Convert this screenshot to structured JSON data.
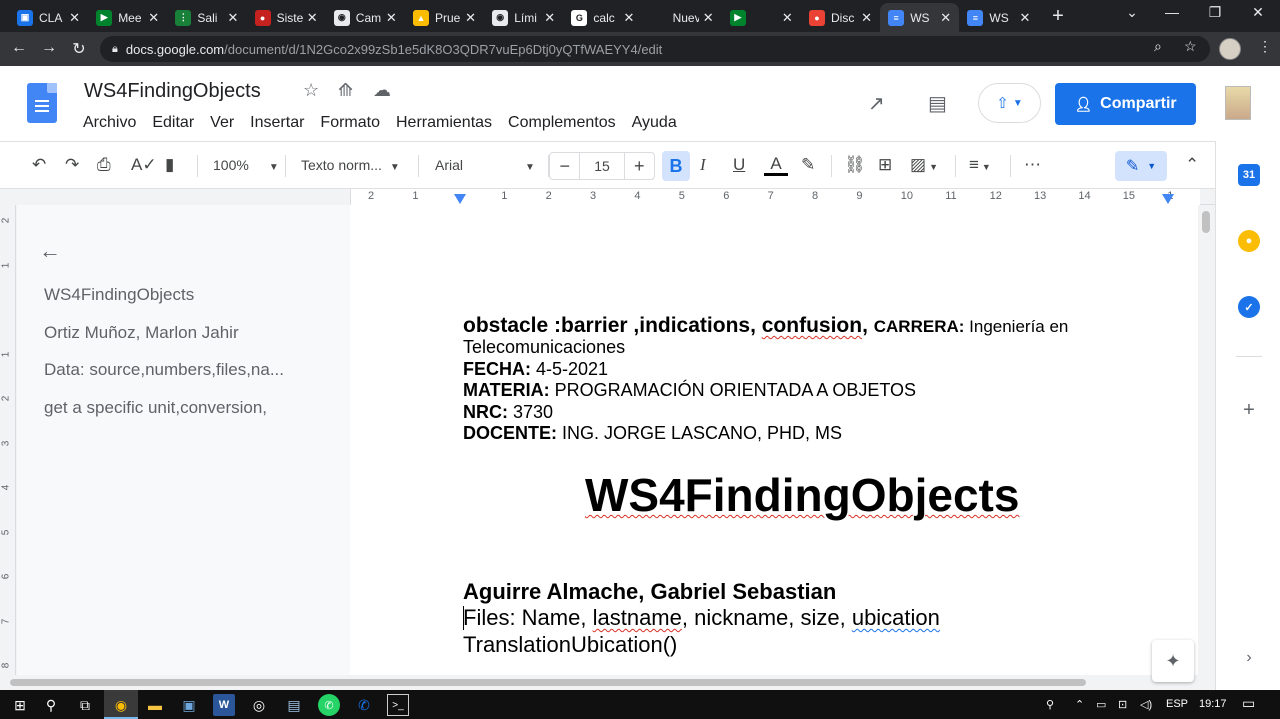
{
  "browser": {
    "tabs": [
      {
        "label": "CLA",
        "color": "#1a73e8",
        "glyph": "▣"
      },
      {
        "label": "Mee",
        "color": "#00832d",
        "glyph": "▶"
      },
      {
        "label": "Sali",
        "color": "#188038",
        "glyph": "⋮"
      },
      {
        "label": "Siste",
        "color": "#c5221f",
        "glyph": "●"
      },
      {
        "label": "Cam",
        "color": "#e8eaed",
        "glyph": "◉"
      },
      {
        "label": "Prue",
        "color": "#fbbc04",
        "glyph": "▲"
      },
      {
        "label": "Lími",
        "color": "#e8eaed",
        "glyph": "◉"
      },
      {
        "label": "calc",
        "color": "#ffffff",
        "glyph": "G"
      },
      {
        "label": "Nueva p",
        "color": "#202124",
        "glyph": ""
      },
      {
        "label": "",
        "color": "#00832d",
        "glyph": "▶"
      },
      {
        "label": "Disc",
        "color": "#ea4335",
        "glyph": "●"
      },
      {
        "label": "WS",
        "color": "#4285f4",
        "glyph": "≡"
      },
      {
        "label": "WS",
        "color": "#4285f4",
        "glyph": "≡"
      }
    ],
    "active_tab_index": 11,
    "url_host": "docs.google.com",
    "url_path": "/document/d/1N2Gco2x99zSb1e5dK8O3QDR7vuEp6Dtj0yQTfWAEYY4/edit"
  },
  "docs": {
    "title": "WS4FindingObjects",
    "menu": [
      "Archivo",
      "Editar",
      "Ver",
      "Insertar",
      "Formato",
      "Herramientas",
      "Complementos",
      "Ayuda"
    ],
    "share_label": "Compartir",
    "toolbar": {
      "zoom": "100%",
      "style": "Texto norm...",
      "font": "Arial",
      "font_size": "15"
    }
  },
  "ruler": {
    "numbers": [
      "2",
      "1",
      "",
      "1",
      "2",
      "3",
      "4",
      "5",
      "6",
      "7",
      "8",
      "9",
      "10",
      "11",
      "12",
      "13",
      "14",
      "15",
      "1"
    ],
    "vertical": [
      "2",
      "1",
      "",
      "1",
      "2",
      "3",
      "4",
      "5",
      "6",
      "7",
      "8"
    ]
  },
  "outline": {
    "items": [
      "WS4FindingObjects",
      "Ortiz Muñoz, Marlon Jahir",
      "Data: source,numbers,files,na...",
      "get a specific unit,conversion,"
    ]
  },
  "document": {
    "line1_a": "obstacle :barrier ,indications, ",
    "line1_b": "confusion",
    "line1_c": ", ",
    "carrera_label": "CARRERA:",
    "carrera_value": " Ingeniería en",
    "carrera_value2": "Telecomunicaciones",
    "fecha_label": "FECHA:",
    "fecha_value": " 4-5-2021",
    "materia_label": "MATERIA:",
    "materia_value": " PROGRAMACIÓN ORIENTADA A OBJETOS",
    "nrc_label": "NRC:",
    "nrc_value": " 3730",
    "docente_label": "DOCENTE:",
    "docente_value": " ING. JORGE LASCANO, PHD, MS",
    "heading": "WS4FindingObjects",
    "author": "Aguirre Almache, Gabriel Sebastian",
    "files_a": "Files: Name, ",
    "files_b": "lastname",
    "files_c": ", nickname, size, ",
    "files_d": "ubication",
    "method": "TranslationUbication()"
  },
  "taskbar": {
    "lang": "ESP",
    "time": "19:17"
  }
}
